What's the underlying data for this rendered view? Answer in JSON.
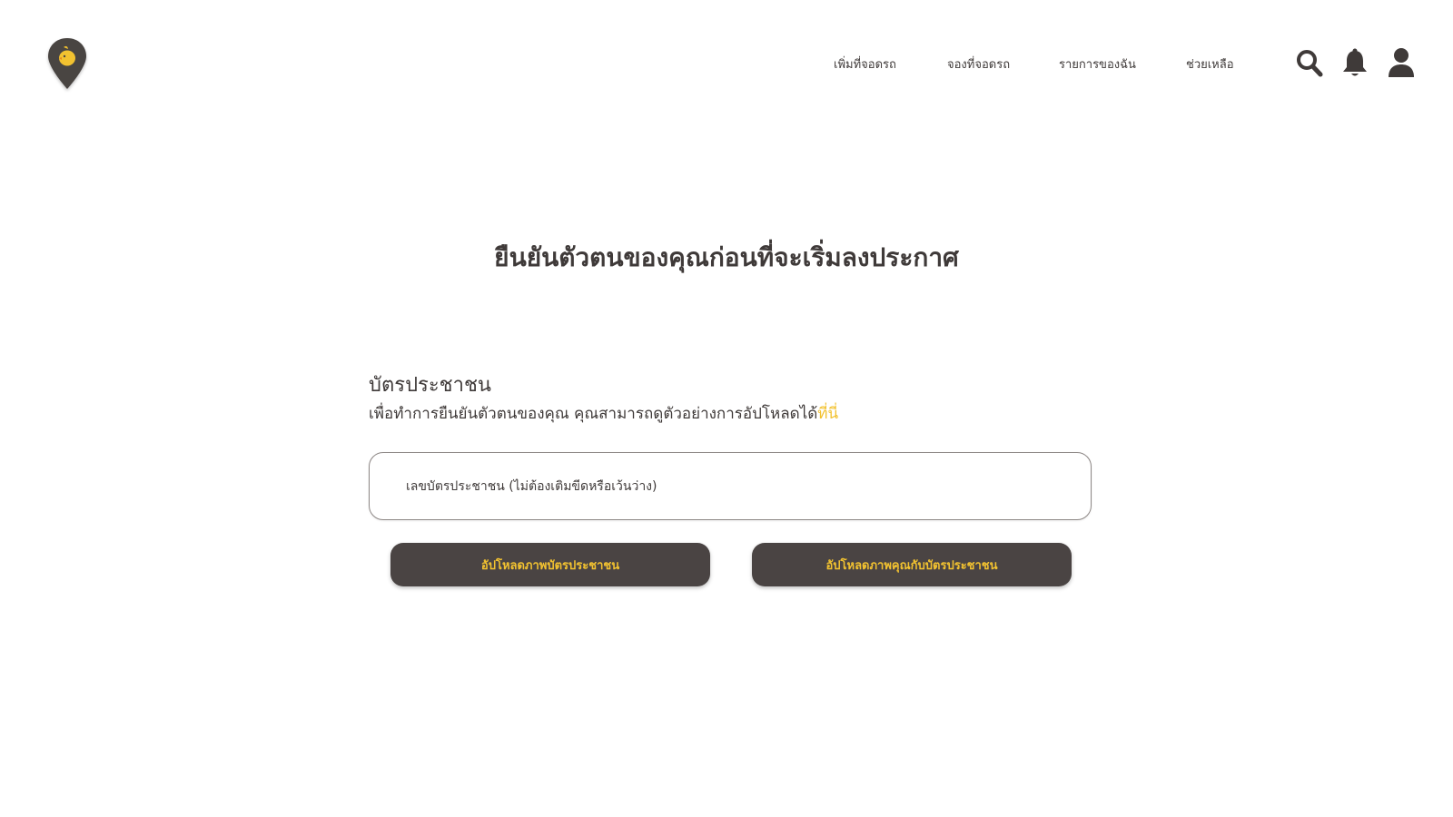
{
  "nav": {
    "items": [
      {
        "label": "เพิ่มที่จอดรถ"
      },
      {
        "label": "จองที่จอดรถ"
      },
      {
        "label": "รายการของฉัน"
      },
      {
        "label": "ช่วยเหลือ"
      }
    ]
  },
  "header_icons": [
    "search-icon",
    "bell-icon",
    "user-icon"
  ],
  "page_title": "ยืนยันตัวตนของคุณก่อนที่จะเริ่มลงประกาศ",
  "id_section": {
    "title": "บัตรประชาชน",
    "description": "เพื่อทำการยืนยันตัวตนของคุณ คุณสามารถดูตัวอย่างการอัปโหลดได้",
    "link_text": "ที่นี่",
    "input_placeholder": "เลขบัตรประชาชน (ไม่ต้องเติมขีดหรือเว้นว่าง)"
  },
  "buttons": {
    "upload_id": "อัปโหลดภาพบัตรประชาชน",
    "upload_selfie": "อัปโหลดภาพคุณกับบัตรประชาชน"
  },
  "colors": {
    "primary_dark": "#4a4443",
    "accent_yellow": "#f2c230",
    "text": "#3f3a39"
  }
}
